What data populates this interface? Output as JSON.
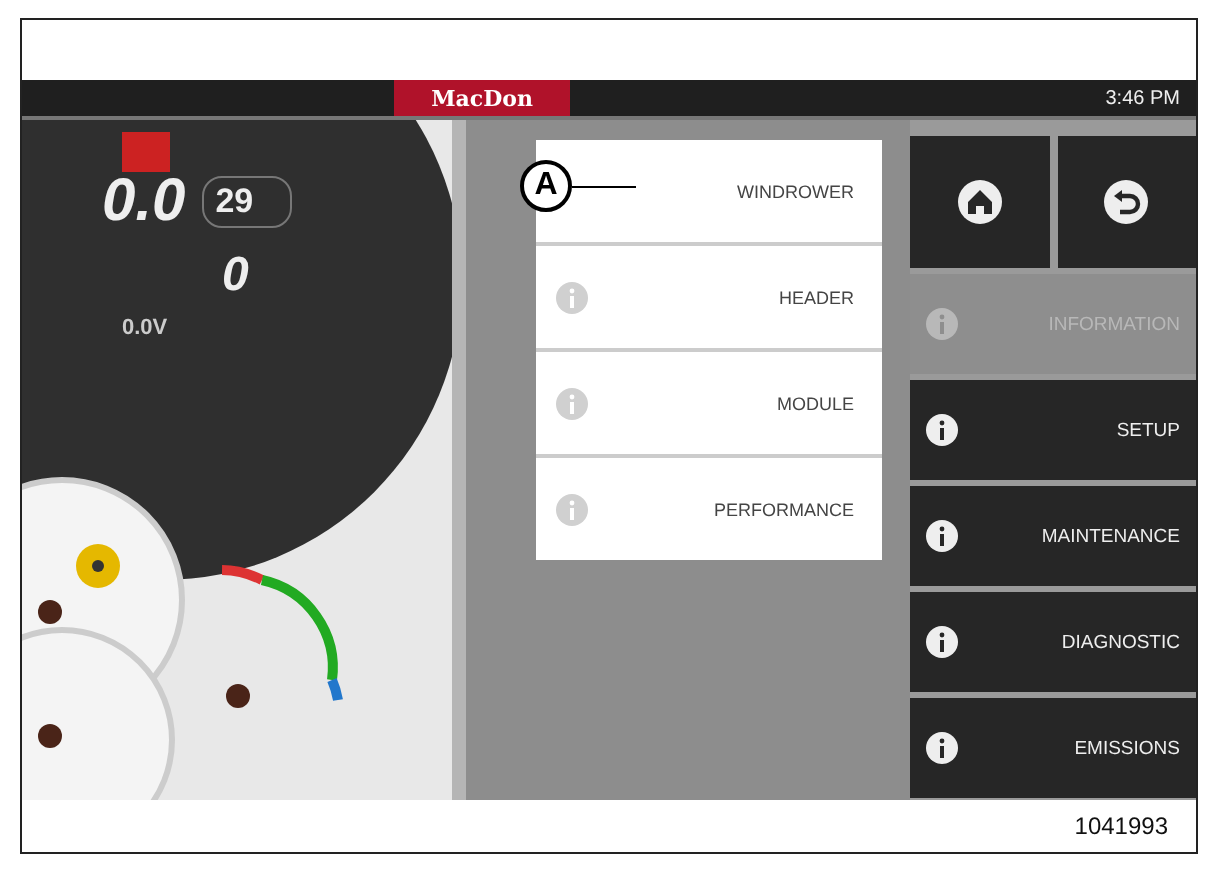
{
  "header": {
    "logo": "MacDon",
    "time": "3:46 PM"
  },
  "dashboard": {
    "speed": "0.0",
    "speed_limit": "29",
    "count": "0",
    "voltage": "0.0V"
  },
  "submenu": [
    {
      "label": "WINDROWER",
      "icon": false
    },
    {
      "label": "HEADER",
      "icon": true
    },
    {
      "label": "MODULE",
      "icon": true
    },
    {
      "label": "PERFORMANCE",
      "icon": true
    }
  ],
  "callout": {
    "label": "A"
  },
  "menu": [
    {
      "label": "INFORMATION",
      "selected": true
    },
    {
      "label": "SETUP",
      "selected": false
    },
    {
      "label": "MAINTENANCE",
      "selected": false
    },
    {
      "label": "DIAGNOSTIC",
      "selected": false
    },
    {
      "label": "EMISSIONS",
      "selected": false
    }
  ],
  "figure_number": "1041993"
}
